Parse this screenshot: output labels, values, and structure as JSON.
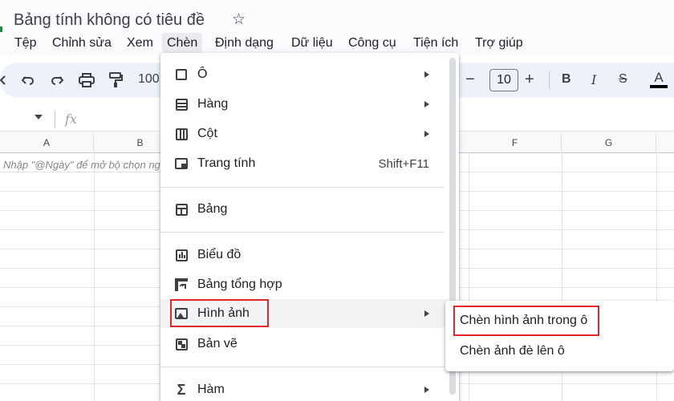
{
  "app": {
    "doc_title": "Bảng tính không có tiêu đề",
    "star_icon": "star-icon"
  },
  "menubar": [
    {
      "label": "Tệp"
    },
    {
      "label": "Chỉnh sửa"
    },
    {
      "label": "Xem"
    },
    {
      "label": "Chèn"
    },
    {
      "label": "Định dạng"
    },
    {
      "label": "Dữ liệu"
    },
    {
      "label": "Công cụ"
    },
    {
      "label": "Tiện ích"
    },
    {
      "label": "Trợ giúp"
    }
  ],
  "toolbar": {
    "zoom": "100",
    "font_size": "10",
    "bold": "B",
    "italic": "I",
    "strikethrough": "S",
    "text_color": "A",
    "minus": "−",
    "plus": "+"
  },
  "formula_bar": {
    "fx": "fx"
  },
  "grid": {
    "columns": [
      "A",
      "B",
      "F",
      "G"
    ],
    "cell_hint": "Nhập \"@Ngày\" để mở bộ chọn ngày"
  },
  "insert_menu": {
    "items": [
      {
        "label": "Ô",
        "icon": "cell-icon"
      },
      {
        "label": "Hàng",
        "icon": "rows-icon"
      },
      {
        "label": "Cột",
        "icon": "columns-icon"
      },
      {
        "label": "Trang tính",
        "icon": "sheet-icon",
        "shortcut": "Shift+F11"
      },
      {
        "label": "Bảng",
        "icon": "table-icon"
      },
      {
        "label": "Biểu đồ",
        "icon": "chart-icon"
      },
      {
        "label": "Bảng tổng hợp",
        "icon": "pivot-table-icon"
      },
      {
        "label": "Hình ảnh",
        "icon": "image-icon"
      },
      {
        "label": "Bản vẽ",
        "icon": "drawing-icon"
      },
      {
        "label": "Hàm",
        "icon": "sigma-icon"
      }
    ]
  },
  "image_submenu": {
    "items": [
      {
        "label": "Chèn hình ảnh trong ô"
      },
      {
        "label": "Chèn ảnh đè lên ô"
      }
    ]
  },
  "colors": {
    "highlight_box": "#e0262b",
    "menu_bg": "#ffffff",
    "toolbar_bg": "#edf2fa"
  }
}
